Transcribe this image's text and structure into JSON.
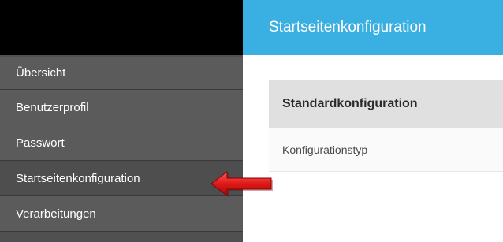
{
  "sidebar": {
    "items": [
      {
        "label": "Übersicht"
      },
      {
        "label": "Benutzerprofil"
      },
      {
        "label": "Passwort"
      },
      {
        "label": "Startseitenkonfiguration"
      },
      {
        "label": "Verarbeitungen"
      }
    ]
  },
  "header": {
    "title": "Startseitenkonfiguration"
  },
  "main": {
    "panel": {
      "heading": "Standardkonfiguration",
      "rows": [
        {
          "label": "Konfigurationstyp"
        }
      ]
    }
  },
  "annotation": {
    "arrow_color": "#e02020",
    "arrow_icon": "red-arrow-left-icon"
  },
  "colors": {
    "header_accent": "#3ab0e2",
    "sidebar_bg": "#5b5b5b",
    "sidebar_top": "#000000"
  }
}
